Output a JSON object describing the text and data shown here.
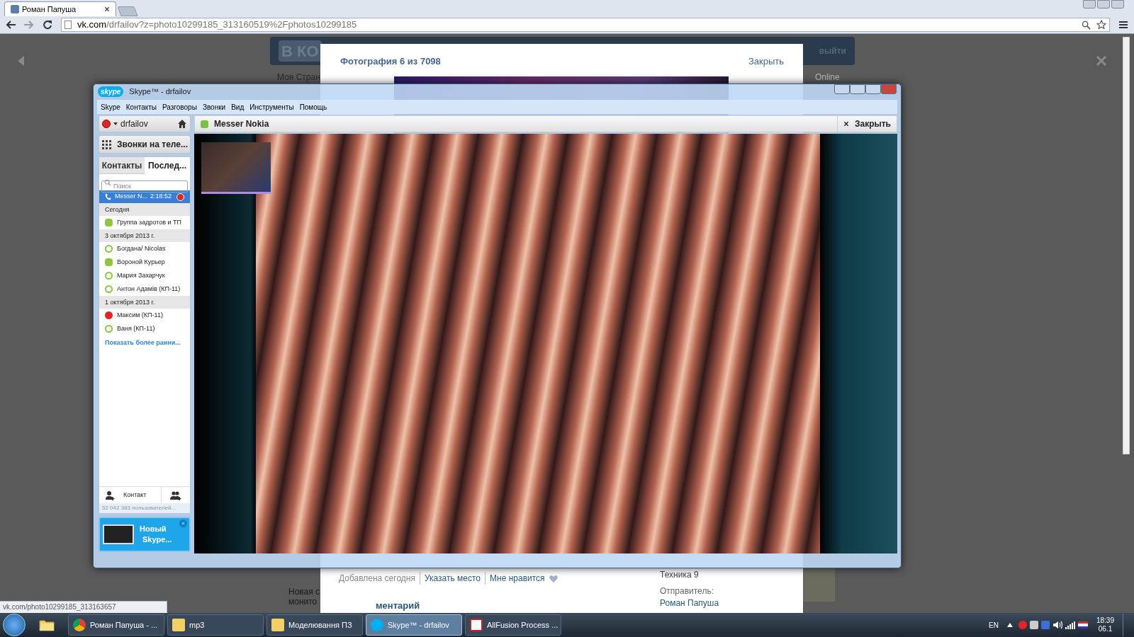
{
  "browser": {
    "tabs": [
      {
        "label": "Роман Папуша",
        "selected": true
      }
    ],
    "url_host": "vk.com",
    "url_path": "/drfailov?z=photo10299185_313160519%2Fphotos10299185",
    "status_url": "vk.com/photo10299185_313163657"
  },
  "vk": {
    "logo": "В КО",
    "logout": "выйти",
    "my_page": "Моя Стран",
    "online": "Online",
    "photo_title": "Фотография 6 из 7098",
    "close": "Закрыть",
    "meta": [
      "Добавлена сегодня",
      "Указать место",
      "Мне нравится"
    ],
    "album": "Техника 9",
    "sender_label": "Отправитель:",
    "sender": "Роман Папуша",
    "comment": "ментарий",
    "side_text": [
      "Новая с",
      "монито"
    ]
  },
  "skype": {
    "logo": "skype",
    "title": "Skype™ - drfailov",
    "menu": [
      "Skype",
      "Контакты",
      "Разговоры",
      "Звонки",
      "Вид",
      "Инструменты",
      "Помощь"
    ],
    "user": "drfailov",
    "phone_button": "Звонки на теле...",
    "tabs": [
      {
        "label": "Контакты",
        "selected": false
      },
      {
        "label": "Послед...",
        "selected": true
      }
    ],
    "search": {
      "placeholder": "Поиск"
    },
    "call": {
      "name": "Messer N...",
      "time": "2:18:52"
    },
    "items": [
      {
        "kind": "date",
        "label": "Сегодня"
      },
      {
        "kind": "group",
        "color": "#8cc63f",
        "label": "Группа задротов и ТП"
      },
      {
        "kind": "date",
        "label": "3 октября 2013 г."
      },
      {
        "kind": "contact",
        "color": "#8cc63f",
        "label": "Богдана/ Nicolas"
      },
      {
        "kind": "group",
        "color": "#8cc63f",
        "label": "Вороной Курьер"
      },
      {
        "kind": "contact",
        "color": "#8cc63f",
        "label": "Мария Захарчук"
      },
      {
        "kind": "contact",
        "color": "#8cc63f",
        "label": "Антон Адамів (КП-11)"
      },
      {
        "kind": "date",
        "label": "1 октября 2013 г."
      },
      {
        "kind": "busy",
        "color": "#e0262b",
        "label": "Максим (КП-11)"
      },
      {
        "kind": "contact",
        "color": "#8cc63f",
        "label": "Ваня (КП-11)"
      }
    ],
    "show_more": "Показать более ранни...",
    "add_contact": "Контакт",
    "users_count": "52 042 383 пользователей...",
    "promo": [
      "Новый",
      "Skype..."
    ],
    "conversation": {
      "name": "Messer Nokia",
      "close": "Закрыть"
    }
  },
  "taskbar": {
    "items": [
      {
        "label": "Роман Папуша - ...",
        "kind": "browser",
        "selected": false
      },
      {
        "label": "mp3",
        "kind": "folder",
        "selected": false
      },
      {
        "label": "Моделювання ПЗ",
        "kind": "folder",
        "selected": false
      },
      {
        "label": "Skype™ - drfailov",
        "kind": "skype",
        "selected": true
      },
      {
        "label": "AllFusion Process ...",
        "kind": "app",
        "selected": false
      }
    ],
    "lang": "EN",
    "time": "18:39",
    "date": "06.1"
  }
}
